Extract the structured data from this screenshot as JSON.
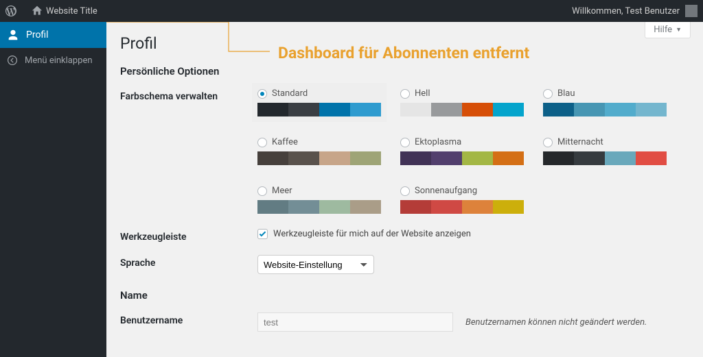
{
  "adminbar": {
    "site_title": "Website Title",
    "welcome": "Willkommen, Test Benutzer"
  },
  "sidebar": {
    "profile": "Profil",
    "collapse": "Menü einklappen"
  },
  "help_tab": "Hilfe",
  "page_title": "Profil",
  "annotation": "Dashboard für Abonnenten entfernt",
  "section_personal": "Persönliche Optionen",
  "labels": {
    "colorscheme": "Farbschema verwalten",
    "toolbar": "Werkzeugleiste",
    "language": "Sprache",
    "username": "Benutzername"
  },
  "schemes": [
    {
      "name": "Standard",
      "selected": true,
      "colors": [
        "#23282d",
        "#3a3e43",
        "#0073aa",
        "#2e9bcf"
      ]
    },
    {
      "name": "Hell",
      "selected": false,
      "colors": [
        "#e5e5e5",
        "#989a9c",
        "#d64e07",
        "#04a4cc"
      ]
    },
    {
      "name": "Blau",
      "selected": false,
      "colors": [
        "#0d6088",
        "#4796b3",
        "#52accc",
        "#74b6ce"
      ]
    },
    {
      "name": "Kaffee",
      "selected": false,
      "colors": [
        "#46403c",
        "#59524c",
        "#c7a589",
        "#9ea476"
      ]
    },
    {
      "name": "Ektoplasma",
      "selected": false,
      "colors": [
        "#413256",
        "#523f6d",
        "#a3b745",
        "#d46f15"
      ]
    },
    {
      "name": "Mitternacht",
      "selected": false,
      "colors": [
        "#25282b",
        "#363b3f",
        "#69a8bb",
        "#e14d43"
      ]
    },
    {
      "name": "Meer",
      "selected": false,
      "colors": [
        "#627c83",
        "#738e96",
        "#9ebaa0",
        "#aa9d88"
      ]
    },
    {
      "name": "Sonnenaufgang",
      "selected": false,
      "colors": [
        "#b43c38",
        "#cf4944",
        "#dd823b",
        "#ccaf0b"
      ]
    }
  ],
  "toolbar_checkbox": {
    "checked": true,
    "label": "Werkzeugleiste für mich auf der Website anzeigen"
  },
  "language_select": {
    "value": "Website-Einstellung"
  },
  "section_name": "Name",
  "username": {
    "value": "test",
    "note": "Benutzernamen können nicht geändert werden."
  }
}
